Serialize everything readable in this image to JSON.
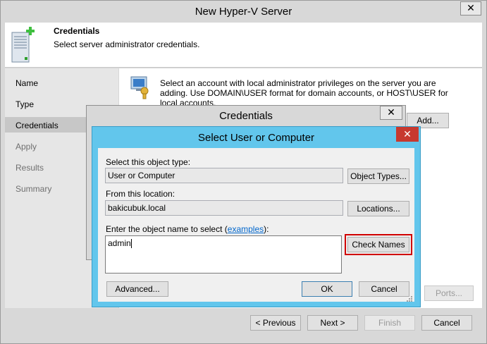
{
  "main_window": {
    "title": "New Hyper-V Server",
    "close_glyph": "✕"
  },
  "header": {
    "title": "Credentials",
    "subtitle": "Select server administrator credentials."
  },
  "nav": {
    "items": [
      {
        "label": "Name"
      },
      {
        "label": "Type"
      },
      {
        "label": "Credentials"
      },
      {
        "label": "Apply"
      },
      {
        "label": "Results"
      },
      {
        "label": "Summary"
      }
    ]
  },
  "content": {
    "description": "Select an account with local administrator privileges on the server you are adding. Use DOMAIN\\USER format for domain accounts, or HOST\\USER for local accounts.",
    "add_button": "Add...",
    "ports_button": "Ports..."
  },
  "footer": {
    "previous": "< Previous",
    "next": "Next >",
    "finish": "Finish",
    "cancel": "Cancel"
  },
  "credentials_dialog": {
    "title": "Credentials",
    "close_glyph": "✕"
  },
  "select_dialog": {
    "title": "Select User or Computer",
    "close_glyph": "✕",
    "object_type_label": "Select this object type:",
    "object_type_value": "User or Computer",
    "object_types_button": "Object Types...",
    "location_label": "From this location:",
    "location_value": "bakicubuk.local",
    "locations_button": "Locations...",
    "name_label_before": "Enter the object name to select (",
    "examples_link": "examples",
    "name_label_after": "):",
    "name_value": "admin",
    "check_names_button": "Check Names",
    "advanced_button": "Advanced...",
    "ok_button": "OK",
    "cancel_button": "Cancel",
    "highlight_color": "#d00000"
  }
}
